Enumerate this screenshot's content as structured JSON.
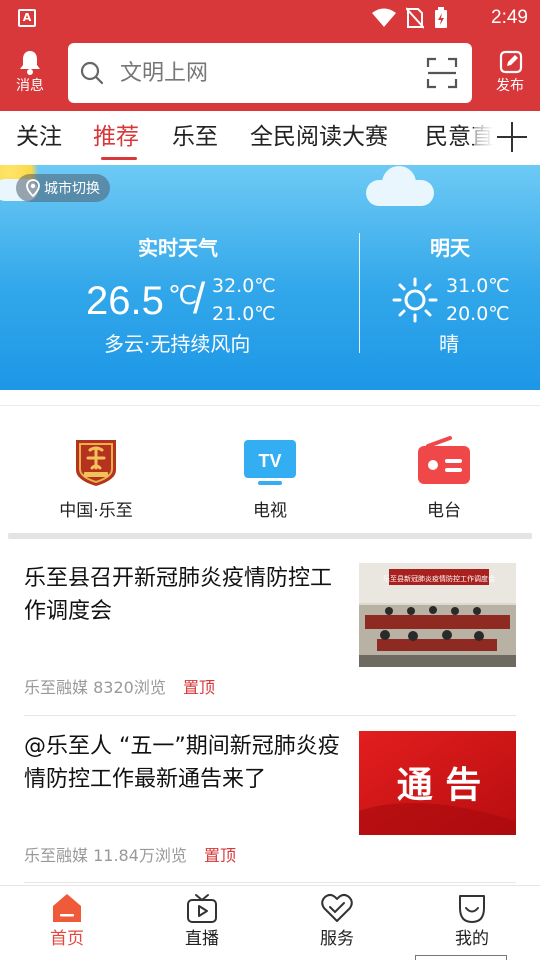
{
  "status_bar": {
    "time": "2:49",
    "app_badge": "A"
  },
  "header": {
    "messages_label": "消息",
    "post_label": "发布",
    "search_placeholder": "文明上网"
  },
  "tabs": [
    {
      "label": "关注"
    },
    {
      "label": "推荐",
      "active": true
    },
    {
      "label": "乐至"
    },
    {
      "label": "全民阅读大赛"
    },
    {
      "label": "民意直"
    }
  ],
  "weather": {
    "city_switch": "城市切换",
    "now_title": "实时天气",
    "now_temp": "26.5",
    "now_unit": "℃",
    "slash": "/",
    "now_high": "32.0℃",
    "now_low": "21.0℃",
    "now_desc": "多云·无持续风向",
    "tomorrow_title": "明天",
    "tomorrow_high": "31.0℃",
    "tomorrow_low": "20.0℃",
    "tomorrow_desc": "晴",
    "tomorrow_icon": "sun-icon"
  },
  "quick_links": [
    {
      "label": "中国·乐至",
      "icon": "lezhi-emblem-icon"
    },
    {
      "label": "电视",
      "icon": "tv-icon"
    },
    {
      "label": "电台",
      "icon": "radio-icon"
    }
  ],
  "news": [
    {
      "title": "乐至县召开新冠肺炎疫情防控工作调度会",
      "source": "乐至融媒",
      "views": "8320浏览",
      "pin": "置顶",
      "image_banner": "乐至县新冠肺炎疫情防控工作调度会"
    },
    {
      "title": "@乐至人 “五一”期间新冠肺炎疫情防控工作最新通告来了",
      "source": "乐至融媒",
      "views": "11.84万浏览",
      "pin": "置顶",
      "image_text": "通 告"
    }
  ],
  "bottom_nav": [
    {
      "label": "首页",
      "icon": "home-icon",
      "active": true
    },
    {
      "label": "直播",
      "icon": "live-tv-icon"
    },
    {
      "label": "服务",
      "icon": "service-heart-icon"
    },
    {
      "label": "我的",
      "icon": "profile-smile-icon"
    }
  ],
  "colors": {
    "brand_red": "#d8383a",
    "weather_blue": "#32a7ea",
    "active_nav": "#e5473f",
    "meta_gray": "#999999"
  }
}
